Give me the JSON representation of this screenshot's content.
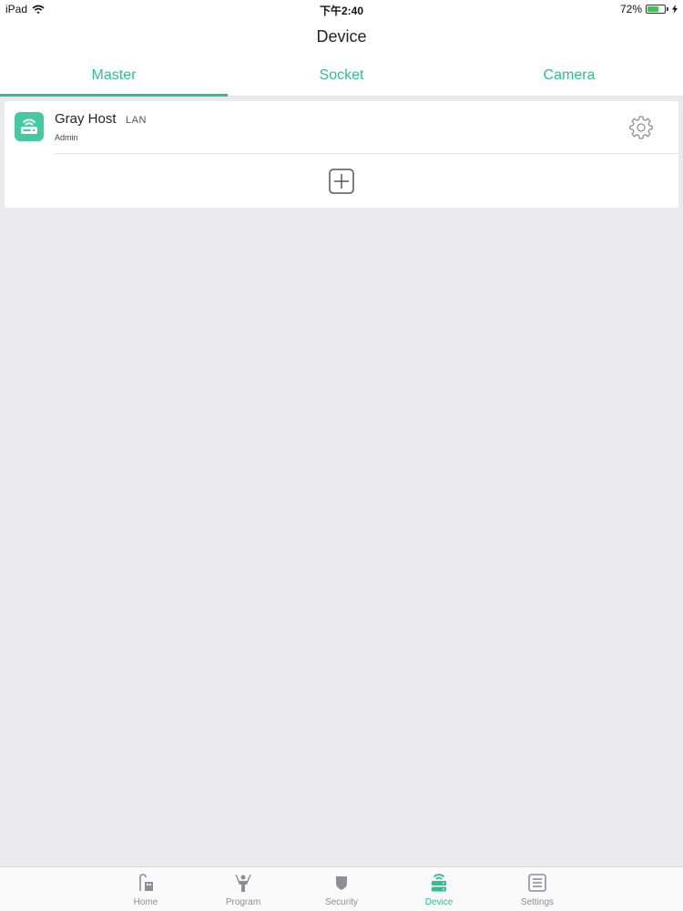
{
  "status_bar": {
    "device": "iPad",
    "time": "下午2:40",
    "battery_text": "72%",
    "battery_level": 0.72
  },
  "nav": {
    "title": "Device"
  },
  "tabs": [
    {
      "label": "Master",
      "active": true
    },
    {
      "label": "Socket",
      "active": false
    },
    {
      "label": "Camera",
      "active": false
    }
  ],
  "device_list": [
    {
      "name": "Gray Host",
      "connection": "LAN",
      "role": "Admin",
      "icon": "router-icon"
    }
  ],
  "add_button": {
    "icon": "add-square-icon"
  },
  "tabbar": {
    "items": [
      {
        "label": "Home",
        "icon": "home-icon",
        "active": false
      },
      {
        "label": "Program",
        "icon": "program-icon",
        "active": false
      },
      {
        "label": "Security",
        "icon": "shield-icon",
        "active": false
      },
      {
        "label": "Device",
        "icon": "device-icon",
        "active": true
      },
      {
        "label": "Settings",
        "icon": "settings-icon",
        "active": false
      }
    ]
  },
  "colors": {
    "accent": "#2ebf91",
    "device_icon_bg": "#44c9a1",
    "background": "#ebebed",
    "inactive": "#8e8e93",
    "battery": "#39c84a"
  }
}
